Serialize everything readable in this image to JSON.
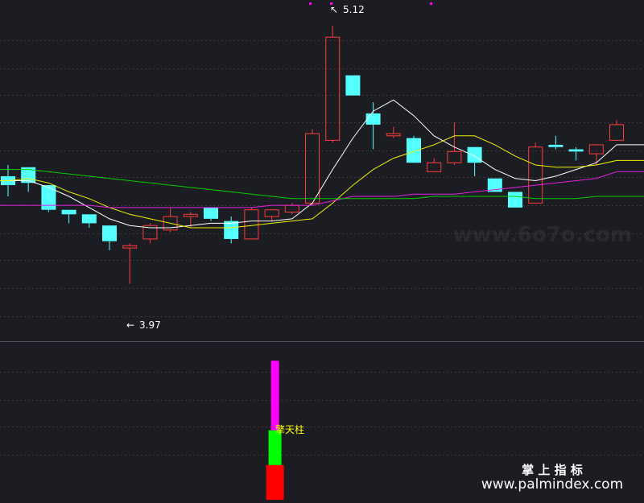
{
  "chart_data": {
    "type": "candlestick",
    "price_axis": {
      "ylim": [
        3.8,
        5.2
      ]
    },
    "candles": [
      {
        "open": 4.45,
        "high": 4.5,
        "low": 4.36,
        "close": 4.41
      },
      {
        "open": 4.49,
        "high": 4.49,
        "low": 4.38,
        "close": 4.42
      },
      {
        "open": 4.41,
        "high": 4.41,
        "low": 4.29,
        "close": 4.3
      },
      {
        "open": 4.3,
        "high": 4.3,
        "low": 4.24,
        "close": 4.28
      },
      {
        "open": 4.28,
        "high": 4.28,
        "low": 4.22,
        "close": 4.24
      },
      {
        "open": 4.23,
        "high": 4.23,
        "low": 4.12,
        "close": 4.16
      },
      {
        "open": 4.13,
        "high": 4.15,
        "low": 3.97,
        "close": 4.14
      },
      {
        "open": 4.17,
        "high": 4.24,
        "low": 4.15,
        "close": 4.23
      },
      {
        "open": 4.21,
        "high": 4.31,
        "low": 4.2,
        "close": 4.27
      },
      {
        "open": 4.27,
        "high": 4.29,
        "low": 4.22,
        "close": 4.28
      },
      {
        "open": 4.31,
        "high": 4.31,
        "low": 4.25,
        "close": 4.26
      },
      {
        "open": 4.25,
        "high": 4.27,
        "low": 4.15,
        "close": 4.17
      },
      {
        "open": 4.17,
        "high": 4.31,
        "low": 4.17,
        "close": 4.3
      },
      {
        "open": 4.27,
        "high": 4.3,
        "low": 4.25,
        "close": 4.3
      },
      {
        "open": 4.29,
        "high": 4.33,
        "low": 4.28,
        "close": 4.32
      },
      {
        "open": 4.33,
        "high": 4.66,
        "low": 4.32,
        "close": 4.64
      },
      {
        "open": 4.61,
        "high": 5.12,
        "low": 4.6,
        "close": 5.07
      },
      {
        "open": 4.9,
        "high": 4.9,
        "low": 4.81,
        "close": 4.81
      },
      {
        "open": 4.73,
        "high": 4.78,
        "low": 4.57,
        "close": 4.68
      },
      {
        "open": 4.63,
        "high": 4.67,
        "low": 4.62,
        "close": 4.64
      },
      {
        "open": 4.62,
        "high": 4.63,
        "low": 4.51,
        "close": 4.51
      },
      {
        "open": 4.47,
        "high": 4.53,
        "low": 4.47,
        "close": 4.51
      },
      {
        "open": 4.51,
        "high": 4.69,
        "low": 4.5,
        "close": 4.56
      },
      {
        "open": 4.58,
        "high": 4.58,
        "low": 4.45,
        "close": 4.51
      },
      {
        "open": 4.44,
        "high": 4.44,
        "low": 4.38,
        "close": 4.38
      },
      {
        "open": 4.38,
        "high": 4.38,
        "low": 4.31,
        "close": 4.31
      },
      {
        "open": 4.33,
        "high": 4.6,
        "low": 4.33,
        "close": 4.58
      },
      {
        "open": 4.59,
        "high": 4.63,
        "low": 4.57,
        "close": 4.58
      },
      {
        "open": 4.57,
        "high": 4.58,
        "low": 4.52,
        "close": 4.56
      },
      {
        "open": 4.55,
        "high": 4.59,
        "low": 4.5,
        "close": 4.59
      },
      {
        "open": 4.61,
        "high": 4.7,
        "low": 4.61,
        "close": 4.68
      }
    ],
    "ma_lines": [
      {
        "color": "#ffffff",
        "values": [
          4.43,
          4.43,
          4.4,
          4.36,
          4.31,
          4.26,
          4.23,
          4.22,
          4.22,
          4.23,
          4.24,
          4.24,
          4.25,
          4.25,
          4.26,
          4.33,
          4.48,
          4.62,
          4.74,
          4.79,
          4.72,
          4.63,
          4.58,
          4.54,
          4.48,
          4.44,
          4.43,
          4.45,
          4.48,
          4.51,
          4.59
        ]
      },
      {
        "color": "#f0f000",
        "values": [
          4.43,
          4.44,
          4.42,
          4.38,
          4.35,
          4.31,
          4.28,
          4.26,
          4.24,
          4.22,
          4.22,
          4.22,
          4.23,
          4.24,
          4.25,
          4.26,
          4.33,
          4.41,
          4.48,
          4.53,
          4.56,
          4.59,
          4.63,
          4.63,
          4.59,
          4.54,
          4.5,
          4.49,
          4.49,
          4.5,
          4.52
        ]
      },
      {
        "color": "#e020e0",
        "values": [
          4.32,
          4.32,
          4.32,
          4.32,
          4.32,
          4.31,
          4.31,
          4.31,
          4.31,
          4.31,
          4.31,
          4.31,
          4.31,
          4.32,
          4.32,
          4.32,
          4.34,
          4.36,
          4.36,
          4.36,
          4.37,
          4.37,
          4.37,
          4.38,
          4.39,
          4.4,
          4.41,
          4.42,
          4.43,
          4.44,
          4.47
        ]
      },
      {
        "color": "#00cc00",
        "values": [
          4.48,
          4.48,
          4.47,
          4.46,
          4.45,
          4.44,
          4.43,
          4.42,
          4.41,
          4.4,
          4.39,
          4.38,
          4.37,
          4.36,
          4.35,
          4.35,
          4.35,
          4.35,
          4.35,
          4.35,
          4.35,
          4.36,
          4.36,
          4.36,
          4.36,
          4.36,
          4.35,
          4.35,
          4.35,
          4.36,
          4.36
        ]
      }
    ],
    "annotations": {
      "high_label": "5.12",
      "low_label": "3.97",
      "indicator_label": "擎天柱"
    },
    "indicator": {
      "candle_index": 13,
      "segments": [
        {
          "color": "#ff0000",
          "value": 4
        },
        {
          "color": "#00ff00",
          "value": 4
        },
        {
          "color": "#ff00ff",
          "value": 8
        }
      ]
    },
    "grid": true
  },
  "watermarks": {
    "faint": "www.6o7o.com",
    "brand_cn": "掌 上 指 标",
    "brand_url": "www.palmindex.com"
  },
  "colors": {
    "background": "#1c1d22",
    "up": "#ff3b3b",
    "down": "#54ffff",
    "grid": "#5a4040",
    "label": "#ffffff",
    "indicator_label": "#ffff00"
  }
}
